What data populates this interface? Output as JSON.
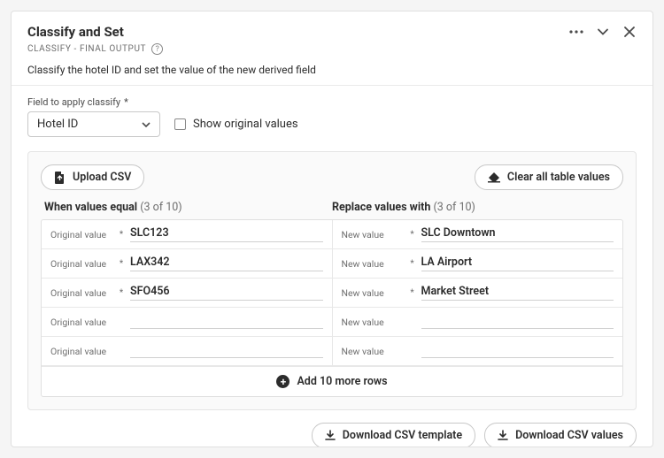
{
  "header": {
    "title": "Classify and Set",
    "subtitle": "CLASSIFY - FINAL OUTPUT",
    "description": "Classify the hotel ID and set the value of the new derived field"
  },
  "field": {
    "label": "Field to apply classify",
    "value": "Hotel ID",
    "checkboxLabel": "Show original values"
  },
  "toolbar": {
    "upload": "Upload CSV",
    "clear": "Clear all table values"
  },
  "columns": {
    "left": "When values equal",
    "leftCount": "(3 of 10)",
    "right": "Replace values with",
    "rightCount": "(3 of 10)",
    "origLabel": "Original value",
    "newLabel": "New value"
  },
  "rows": [
    {
      "orig": "SLC123",
      "repl": "SLC Downtown",
      "filled": true
    },
    {
      "orig": "LAX342",
      "repl": "LA Airport",
      "filled": true
    },
    {
      "orig": "SFO456",
      "repl": "Market Street",
      "filled": true
    },
    {
      "orig": "",
      "repl": "",
      "filled": false
    },
    {
      "orig": "",
      "repl": "",
      "filled": false
    }
  ],
  "addRows": "Add 10 more rows",
  "footer": {
    "downloadTemplate": "Download CSV template",
    "downloadValues": "Download CSV values"
  }
}
